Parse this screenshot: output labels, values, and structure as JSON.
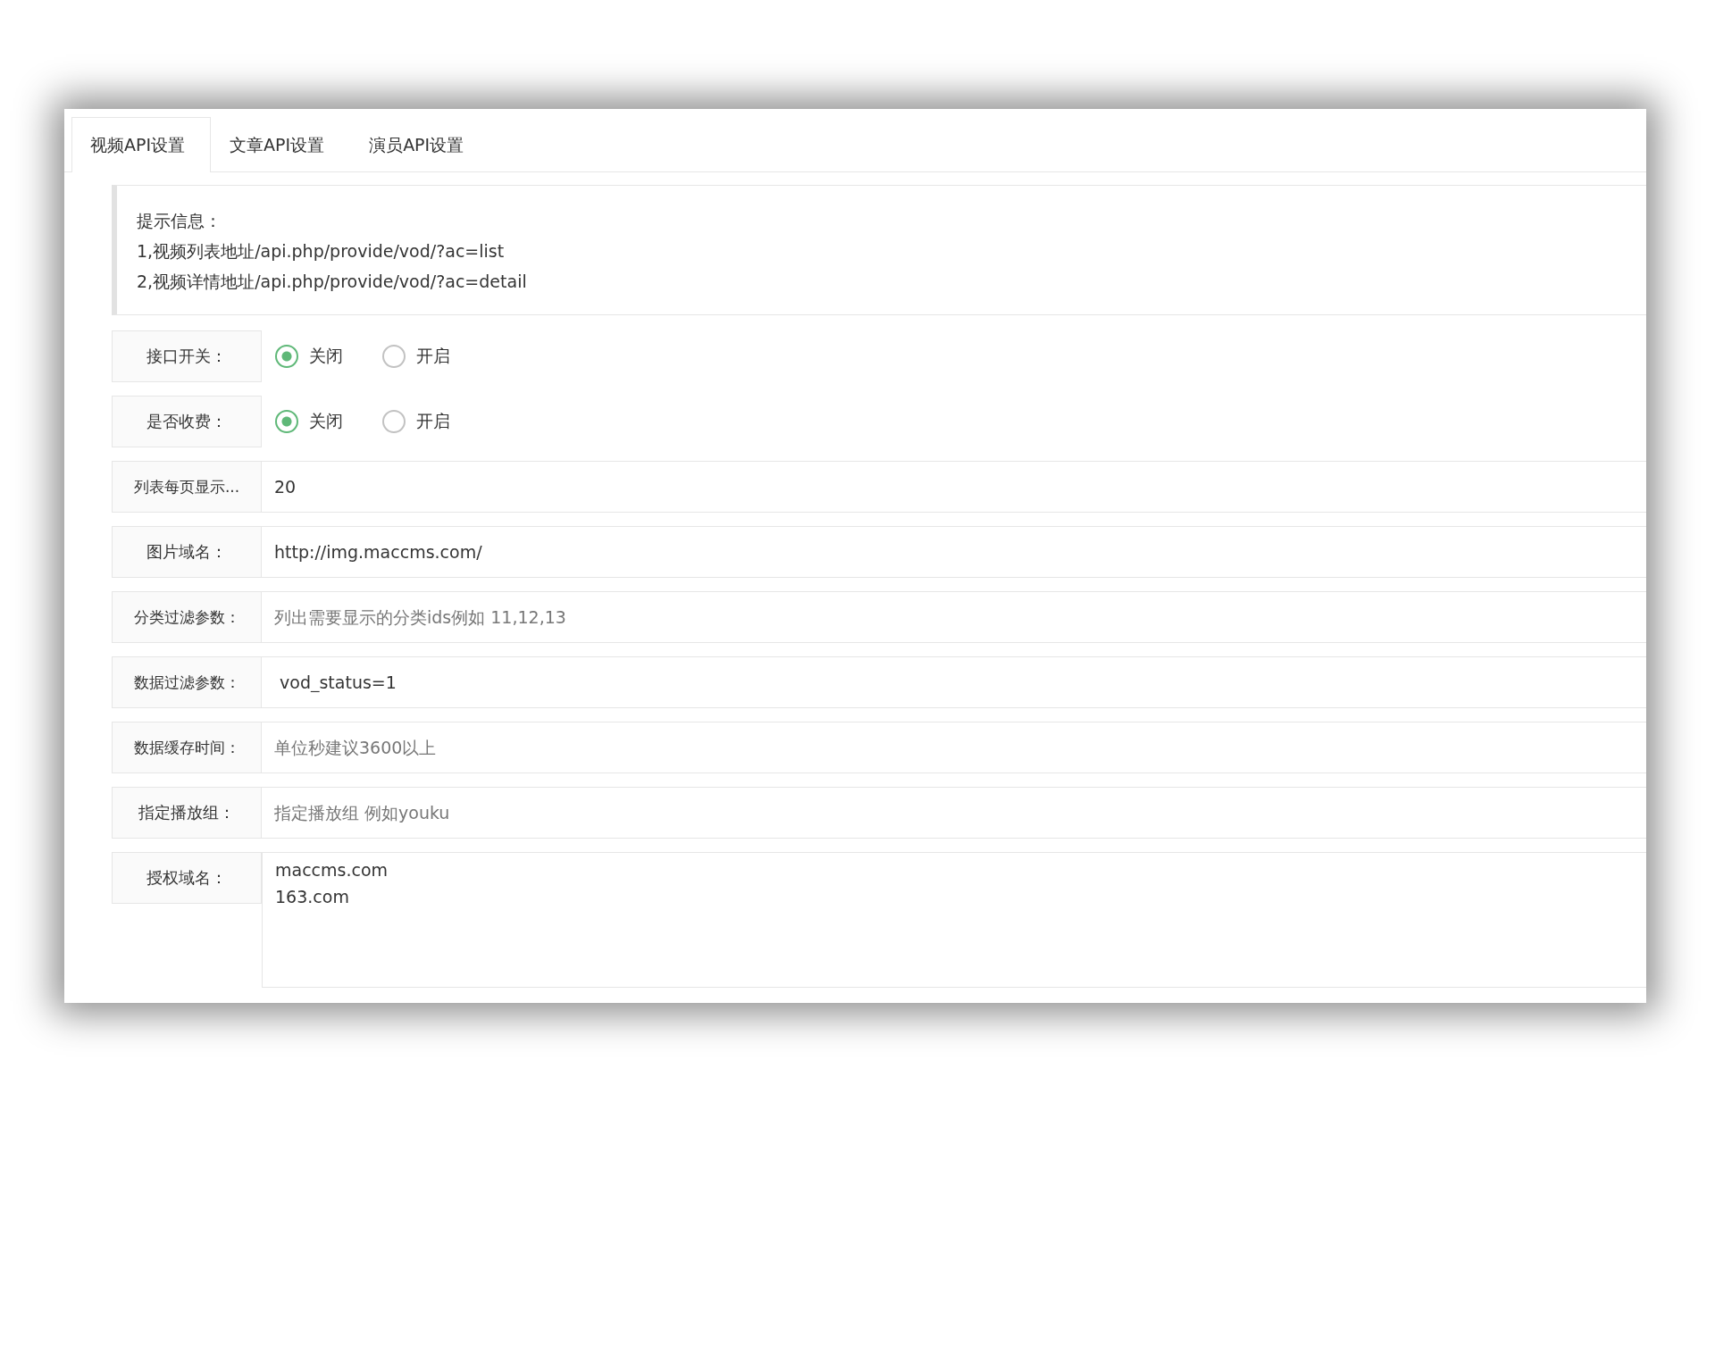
{
  "tabs": [
    {
      "label": "视频API设置",
      "selected": true
    },
    {
      "label": "文章API设置",
      "selected": false
    },
    {
      "label": "演员API设置",
      "selected": false
    }
  ],
  "notice": {
    "title": "提示信息：",
    "lines": [
      "1,视频列表地址/api.php/provide/vod/?ac=list",
      "2,视频详情地址/api.php/provide/vod/?ac=detail"
    ]
  },
  "fields": [
    {
      "kind": "radio",
      "label": "接口开关：",
      "options": [
        {
          "label": "关闭",
          "selected": true
        },
        {
          "label": "开启",
          "selected": false
        }
      ]
    },
    {
      "kind": "radio",
      "label": "是否收费：",
      "options": [
        {
          "label": "关闭",
          "selected": true
        },
        {
          "label": "开启",
          "selected": false
        }
      ]
    },
    {
      "kind": "input",
      "label": "列表每页显示...",
      "value": "20"
    },
    {
      "kind": "input",
      "label": "图片域名：",
      "value": "http://img.maccms.com/"
    },
    {
      "kind": "input",
      "label": "分类过滤参数：",
      "placeholder": "列出需要显示的分类ids例如 11,12,13"
    },
    {
      "kind": "input",
      "label": "数据过滤参数：",
      "value": " vod_status=1"
    },
    {
      "kind": "input",
      "label": "数据缓存时间：",
      "placeholder": "单位秒建议3600以上"
    },
    {
      "kind": "input",
      "label": "指定播放组：",
      "placeholder": "指定播放组 例如youku"
    },
    {
      "kind": "textarea",
      "label": "授权域名：",
      "value": "maccms.com\n163.com"
    }
  ]
}
